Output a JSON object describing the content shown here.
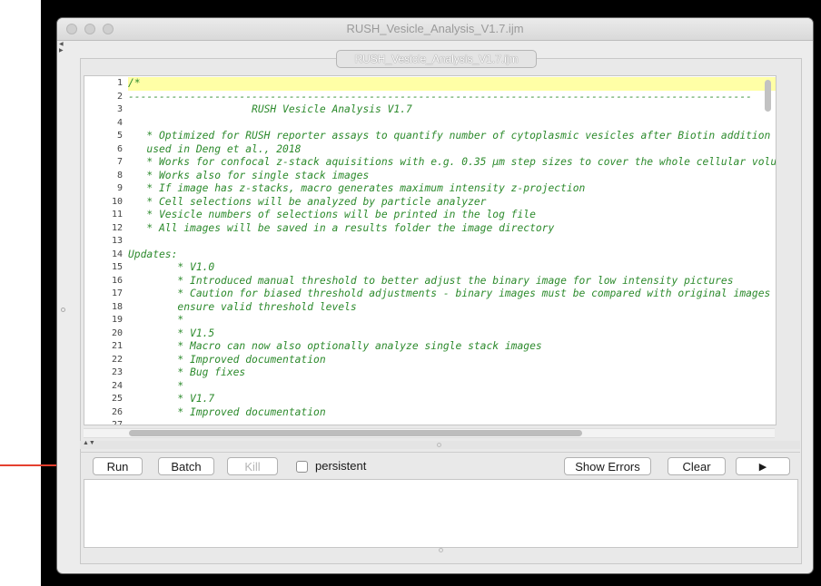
{
  "window": {
    "title": "RUSH_Vesicle_Analysis_V1.7.ijm",
    "tab_label": "RUSH_Vesicle_Analysis_V1.7.ijm"
  },
  "editor": {
    "lines": [
      {
        "n": "1",
        "text": "/*"
      },
      {
        "n": "2",
        "text": "-----------------------------------------------------------------------------------------------------"
      },
      {
        "n": "3",
        "text": "                    RUSH Vesicle Analysis V1.7"
      },
      {
        "n": "4",
        "text": ""
      },
      {
        "n": "5",
        "text": "   * Optimized for RUSH reporter assays to quantify number of cytoplasmic vesicles after Biotin addition"
      },
      {
        "n": "6",
        "text": "   used in Deng et al., 2018"
      },
      {
        "n": "7",
        "text": "   * Works for confocal z-stack aquisitions with e.g. 0.35 µm step sizes to cover the whole cellular volu"
      },
      {
        "n": "8",
        "text": "   * Works also for single stack images"
      },
      {
        "n": "9",
        "text": "   * If image has z-stacks, macro generates maximum intensity z-projection"
      },
      {
        "n": "10",
        "text": "   * Cell selections will be analyzed by particle analyzer"
      },
      {
        "n": "11",
        "text": "   * Vesicle numbers of selections will be printed in the log file"
      },
      {
        "n": "12",
        "text": "   * All images will be saved in a results folder the image directory"
      },
      {
        "n": "13",
        "text": ""
      },
      {
        "n": "14",
        "text": "Updates:"
      },
      {
        "n": "15",
        "text": "        * V1.0"
      },
      {
        "n": "16",
        "text": "        * Introduced manual threshold to better adjust the binary image for low intensity pictures"
      },
      {
        "n": "17",
        "text": "        * Caution for biased threshold adjustments - binary images must be compared with original images t"
      },
      {
        "n": "18",
        "text": "        ensure valid threshold levels"
      },
      {
        "n": "19",
        "text": "        *"
      },
      {
        "n": "20",
        "text": "        * V1.5"
      },
      {
        "n": "21",
        "text": "        * Macro can now also optionally analyze single stack images"
      },
      {
        "n": "22",
        "text": "        * Improved documentation"
      },
      {
        "n": "23",
        "text": "        * Bug fixes"
      },
      {
        "n": "24",
        "text": "        *"
      },
      {
        "n": "25",
        "text": "        * V1.7"
      },
      {
        "n": "26",
        "text": "        * Improved documentation"
      },
      {
        "n": "27",
        "text": ""
      }
    ]
  },
  "buttons": {
    "run": "Run",
    "batch": "Batch",
    "kill": "Kill",
    "persistent": "persistent",
    "show_errors": "Show Errors",
    "clear": "Clear",
    "play": "▶"
  },
  "colors": {
    "code_text": "#2c8a2c",
    "current_line_highlight": "#ffffa6",
    "annotation_arrow": "#e5402f"
  },
  "icons": {
    "play": "play-icon",
    "side_collapse": "collapse-arrows-icon"
  }
}
